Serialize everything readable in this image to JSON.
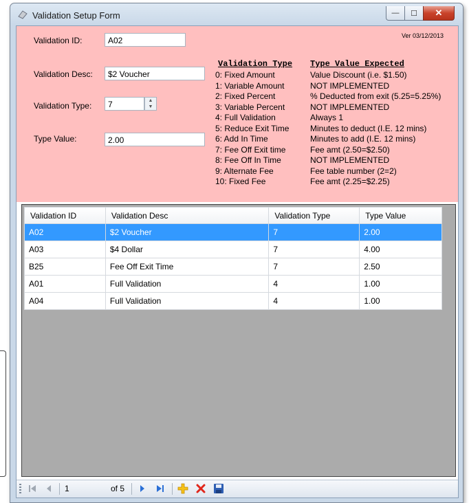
{
  "window": {
    "title": "Validation Setup Form",
    "minimize": "—",
    "maximize": "☐",
    "close": "✕"
  },
  "form": {
    "version": "Ver 03/12/2013",
    "validation_id_label": "Validation ID:",
    "validation_id_value": "A02",
    "validation_desc_label": "Validation Desc:",
    "validation_desc_value": "$2 Voucher",
    "validation_type_label": "Validation Type:",
    "validation_type_value": "7",
    "type_value_label": "Type Value:",
    "type_value_value": "2.00"
  },
  "reference": {
    "header_type": "Validation Type",
    "header_expected": "Type Value Expected",
    "types": [
      "0: Fixed Amount",
      "1: Variable Amount",
      "2: Fixed Percent",
      "3: Variable Percent",
      "4: Full Validation",
      "5: Reduce Exit Time",
      "6: Add In Time",
      "7: Fee Off Exit time",
      "8: Fee Off In Time",
      "9: Alternate Fee",
      "10: Fixed Fee"
    ],
    "expected": [
      "Value Discount (i.e. $1.50)",
      "NOT IMPLEMENTED",
      "% Deducted from exit (5.25=5.25%)",
      "NOT IMPLEMENTED",
      "Always 1",
      "Minutes to deduct (I.E. 12 mins)",
      "Minutes to add (I.E. 12 mins)",
      "Fee amt (2.50=$2.50)",
      "NOT IMPLEMENTED",
      "Fee table number (2=2)",
      "Fee amt (2.25=$2.25)"
    ]
  },
  "grid": {
    "columns": [
      "Validation ID",
      "Validation Desc",
      "Validation Type",
      "Type Value"
    ],
    "rows": [
      [
        "A02",
        "$2 Voucher",
        "7",
        "2.00"
      ],
      [
        "A03",
        "$4 Dollar",
        "7",
        "4.00"
      ],
      [
        "B25",
        "Fee Off Exit Time",
        "7",
        "2.50"
      ],
      [
        "A01",
        "Full Validation",
        "4",
        "1.00"
      ],
      [
        "A04",
        "Full Validation",
        "4",
        "1.00"
      ]
    ],
    "selected_row": 0
  },
  "navigator": {
    "position": "1",
    "count": "of 5"
  },
  "colors": {
    "form_bg": "#ffbfbf",
    "selection": "#3399ff",
    "grid_bg": "#ababab"
  }
}
